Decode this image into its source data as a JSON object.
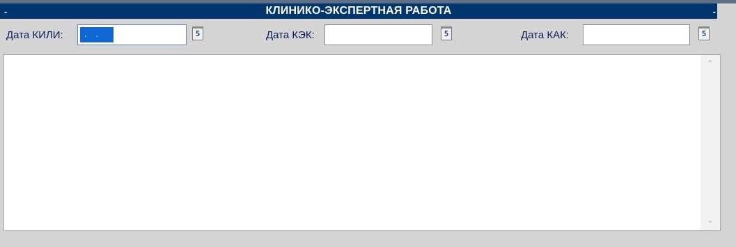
{
  "header": {
    "title": "КЛИНИКО-ЭКСПЕРТНАЯ РАБОТА",
    "collapse_left": "-",
    "collapse_right": "-"
  },
  "fields": {
    "kili": {
      "label": "Дата КИЛИ:",
      "value": ". ."
    },
    "kek": {
      "label": "Дата КЭК:",
      "value": ""
    },
    "kak": {
      "label": "Дата КАК:",
      "value": ""
    },
    "calendar_glyph": "5"
  },
  "notes": {
    "value": ""
  },
  "colors": {
    "header_bg": "#00356e",
    "label_text": "#0c1f5a",
    "selection": "#0f67d6",
    "panel_bg": "#d4d4d4"
  }
}
